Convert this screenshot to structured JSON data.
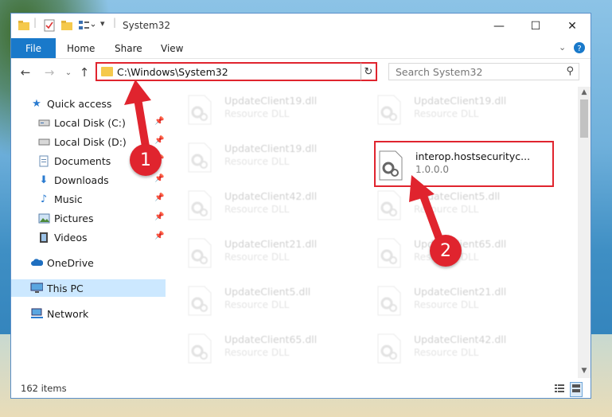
{
  "window": {
    "title": "System32"
  },
  "ribbon": {
    "tabs": [
      "File",
      "Home",
      "Share",
      "View"
    ]
  },
  "address": {
    "path": "C:\\Windows\\System32"
  },
  "search": {
    "placeholder": "Search System32"
  },
  "nav": {
    "items": [
      {
        "label": "Quick access",
        "icon": "star-icon",
        "pinned": false
      },
      {
        "label": "Local Disk (C:)",
        "icon": "drive-icon",
        "pinned": true
      },
      {
        "label": "Local Disk (D:)",
        "icon": "drive-icon",
        "pinned": true
      },
      {
        "label": "Documents",
        "icon": "documents-icon",
        "pinned": true
      },
      {
        "label": "Downloads",
        "icon": "download-arrow-icon",
        "pinned": true
      },
      {
        "label": "Music",
        "icon": "music-note-icon",
        "pinned": true
      },
      {
        "label": "Pictures",
        "icon": "pictures-icon",
        "pinned": true
      },
      {
        "label": "Videos",
        "icon": "film-icon",
        "pinned": true
      },
      {
        "label": "OneDrive",
        "icon": "cloud-icon",
        "pinned": false
      },
      {
        "label": "This PC",
        "icon": "monitor-icon",
        "pinned": false,
        "selected": true
      },
      {
        "label": "Network",
        "icon": "network-icon",
        "pinned": false
      }
    ]
  },
  "files": [
    {
      "name": "UpdateClient19.dll",
      "desc": "Resource DLL"
    },
    {
      "name": "UpdateClient19.dll",
      "desc": "Resource DLL"
    },
    {
      "name": "UpdateClient19.dll",
      "desc": "Resource DLL"
    },
    {
      "name": "interop.hostsecurityc...",
      "desc": "1.0.0.0"
    },
    {
      "name": "UpdateClient42.dll",
      "desc": "Resource DLL"
    },
    {
      "name": "UpdateClient5.dll",
      "desc": "Resource DLL"
    },
    {
      "name": "UpdateClient21.dll",
      "desc": "Resource DLL"
    },
    {
      "name": "UpdateClient65.dll",
      "desc": "Resource DLL"
    },
    {
      "name": "UpdateClient5.dll",
      "desc": "Resource DLL"
    },
    {
      "name": "UpdateClient21.dll",
      "desc": "Resource DLL"
    },
    {
      "name": "UpdateClient65.dll",
      "desc": "Resource DLL"
    },
    {
      "name": "UpdateClient42.dll",
      "desc": "Resource DLL"
    }
  ],
  "status": {
    "items_count": "162 items"
  },
  "annotations": {
    "step1": "1",
    "step2": "2",
    "color": "#e0242e"
  }
}
